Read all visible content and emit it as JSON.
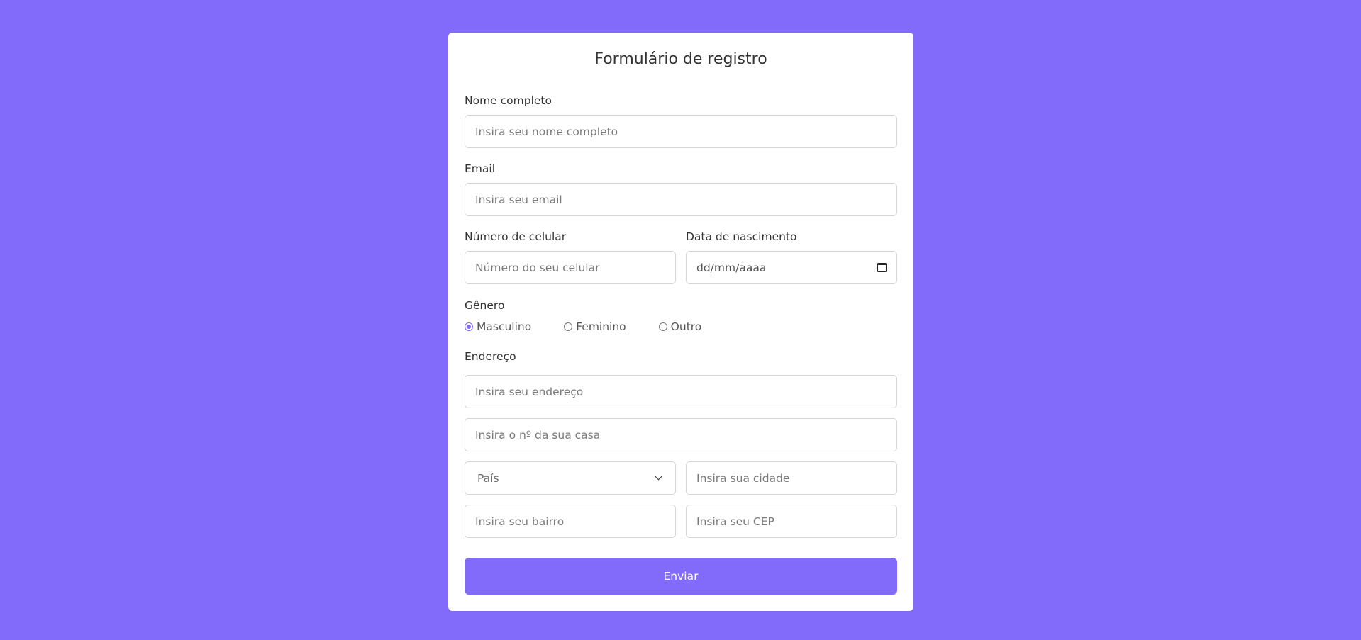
{
  "form": {
    "title": "Formulário de registro",
    "full_name": {
      "label": "Nome completo",
      "placeholder": "Insira seu nome completo"
    },
    "email": {
      "label": "Email",
      "placeholder": "Insira seu email"
    },
    "phone": {
      "label": "Número de celular",
      "placeholder": "Número do seu celular"
    },
    "birth_date": {
      "label": "Data de nascimento",
      "placeholder": "dd/mm/aaaa"
    },
    "gender": {
      "label": "Gênero",
      "options": [
        {
          "label": "Masculino",
          "checked": true
        },
        {
          "label": "Feminino",
          "checked": false
        },
        {
          "label": "Outro",
          "checked": false
        }
      ]
    },
    "address": {
      "label": "Endereço",
      "street_placeholder": "Insira seu endereço",
      "number_placeholder": "Insira o nº da sua casa",
      "country_selected": "País",
      "city_placeholder": "Insira sua cidade",
      "neighborhood_placeholder": "Insira seu bairro",
      "zip_placeholder": "Insira seu CEP"
    },
    "submit_label": "Enviar"
  },
  "colors": {
    "background": "#826bfa",
    "accent": "#826bfa",
    "card": "#ffffff"
  },
  "icons": [
    "calendar-icon",
    "chevron-down-icon"
  ]
}
